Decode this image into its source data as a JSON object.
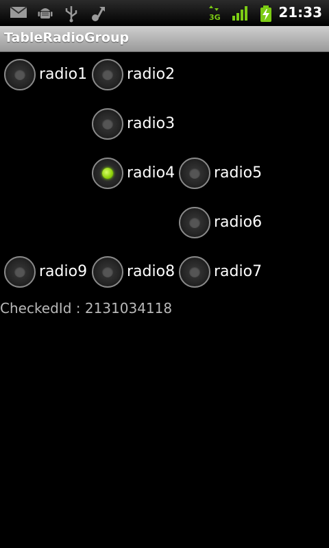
{
  "status_bar": {
    "icons": [
      "gmail-icon",
      "android-debug-icon",
      "usb-icon",
      "music-share-icon",
      "3g-data-icon",
      "signal-strength-icon",
      "battery-charging-icon"
    ],
    "time": "21:33"
  },
  "title_bar": {
    "title": "TableRadioGroup"
  },
  "radios": [
    {
      "label": "radio1",
      "checked": false
    },
    {
      "label": "radio2",
      "checked": false
    },
    {
      "label": "radio3",
      "checked": false
    },
    {
      "label": "radio4",
      "checked": true
    },
    {
      "label": "radio5",
      "checked": false
    },
    {
      "label": "radio6",
      "checked": false
    },
    {
      "label": "radio9",
      "checked": false
    },
    {
      "label": "radio8",
      "checked": false
    },
    {
      "label": "radio7",
      "checked": false
    }
  ],
  "checked_id_text": "CheckedId : 2131034118",
  "colors": {
    "checked_green": "#8fd10a",
    "status_green": "#7ccc14"
  }
}
